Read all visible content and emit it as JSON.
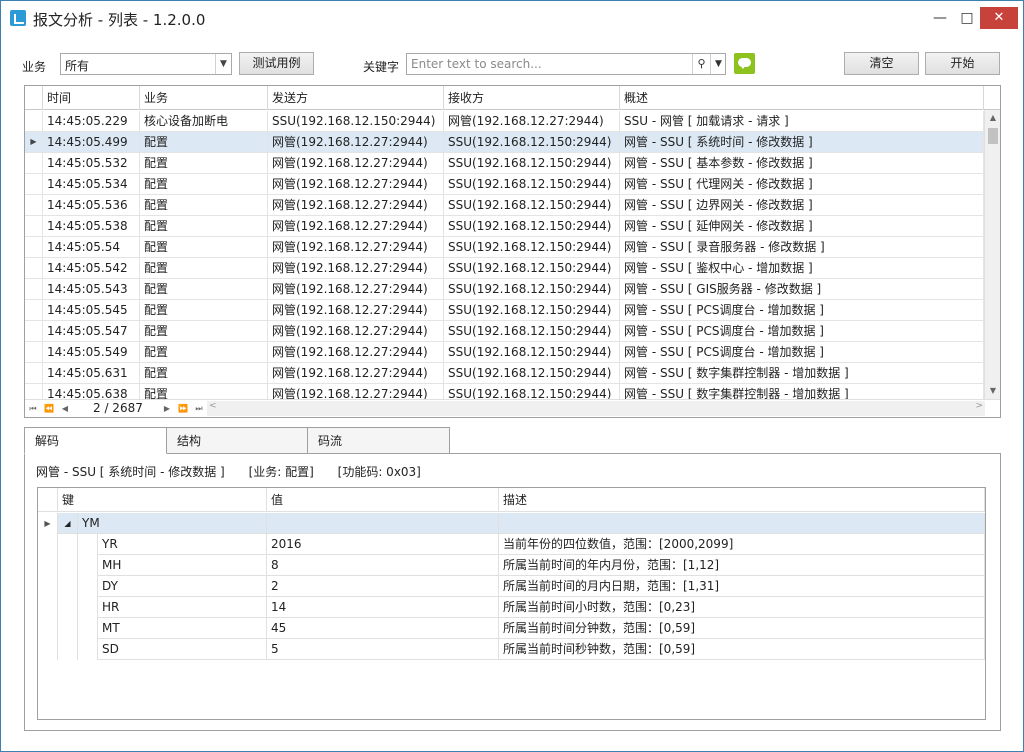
{
  "window": {
    "title": "报文分析 - 列表 - 1.2.0.0",
    "min_icon": "minimize-icon",
    "max_icon": "maximize-icon",
    "close_icon": "close-icon",
    "close_color": "#c7423a"
  },
  "toolbar": {
    "business_label": "业务",
    "business_value": "所有",
    "test_button": "测试用例",
    "keyword_label": "关键字",
    "search_placeholder": "Enter text to search...",
    "clear_button": "清空",
    "start_button": "开始",
    "chat_icon_color": "#8dc21f"
  },
  "grid": {
    "columns": [
      "时间",
      "业务",
      "发送方",
      "接收方",
      "概述"
    ],
    "rows": [
      [
        "14:45:05.229",
        "核心设备加断电",
        "SSU(192.168.12.150:2944)",
        "网管(192.168.12.27:2944)",
        "SSU - 网管 [ 加载请求 - 请求 ]"
      ],
      [
        "14:45:05.499",
        "配置",
        "网管(192.168.12.27:2944)",
        "SSU(192.168.12.150:2944)",
        "网管 - SSU [ 系统时间 - 修改数据 ]"
      ],
      [
        "14:45:05.532",
        "配置",
        "网管(192.168.12.27:2944)",
        "SSU(192.168.12.150:2944)",
        "网管 - SSU [ 基本参数 - 修改数据 ]"
      ],
      [
        "14:45:05.534",
        "配置",
        "网管(192.168.12.27:2944)",
        "SSU(192.168.12.150:2944)",
        "网管 - SSU [ 代理网关 - 修改数据 ]"
      ],
      [
        "14:45:05.536",
        "配置",
        "网管(192.168.12.27:2944)",
        "SSU(192.168.12.150:2944)",
        "网管 - SSU [ 边界网关 - 修改数据 ]"
      ],
      [
        "14:45:05.538",
        "配置",
        "网管(192.168.12.27:2944)",
        "SSU(192.168.12.150:2944)",
        "网管 - SSU [ 延伸网关 - 修改数据 ]"
      ],
      [
        "14:45:05.54",
        "配置",
        "网管(192.168.12.27:2944)",
        "SSU(192.168.12.150:2944)",
        "网管 - SSU [ 录音服务器 - 修改数据 ]"
      ],
      [
        "14:45:05.542",
        "配置",
        "网管(192.168.12.27:2944)",
        "SSU(192.168.12.150:2944)",
        "网管 - SSU [ 鉴权中心 - 增加数据 ]"
      ],
      [
        "14:45:05.543",
        "配置",
        "网管(192.168.12.27:2944)",
        "SSU(192.168.12.150:2944)",
        "网管 - SSU [ GIS服务器 - 修改数据 ]"
      ],
      [
        "14:45:05.545",
        "配置",
        "网管(192.168.12.27:2944)",
        "SSU(192.168.12.150:2944)",
        "网管 - SSU [ PCS调度台 - 增加数据 ]"
      ],
      [
        "14:45:05.547",
        "配置",
        "网管(192.168.12.27:2944)",
        "SSU(192.168.12.150:2944)",
        "网管 - SSU [ PCS调度台 - 增加数据 ]"
      ],
      [
        "14:45:05.549",
        "配置",
        "网管(192.168.12.27:2944)",
        "SSU(192.168.12.150:2944)",
        "网管 - SSU [ PCS调度台 - 增加数据 ]"
      ],
      [
        "14:45:05.631",
        "配置",
        "网管(192.168.12.27:2944)",
        "SSU(192.168.12.150:2944)",
        "网管 - SSU [ 数字集群控制器 - 增加数据 ]"
      ],
      [
        "14:45:05.638",
        "配置",
        "网管(192.168.12.27:2944)",
        "SSU(192.168.12.150:2944)",
        "网管 - SSU [ 数字集群控制器 - 增加数据 ]"
      ]
    ],
    "selected_row": 1,
    "pager": "2 / 2687"
  },
  "tabs": [
    "解码",
    "结构",
    "码流"
  ],
  "active_tab": 0,
  "detail": {
    "summary": "网管 - SSU [ 系统时间 - 修改数据 ]",
    "business": "[业务: 配置]",
    "function_code": "[功能码: 0x03]",
    "columns": [
      "键",
      "值",
      "描述"
    ],
    "group": "YM",
    "rows": [
      [
        "YR",
        "2016",
        "当前年份的四位数值，范围：[2000,2099]"
      ],
      [
        "MH",
        "8",
        "所属当前时间的年内月份，范围：[1,12]"
      ],
      [
        "DY",
        "2",
        "所属当前时间的月内日期，范围：[1,31]"
      ],
      [
        "HR",
        "14",
        "所属当前时间小时数，范围：[0,23]"
      ],
      [
        "MT",
        "45",
        "所属当前时间分钟数，范围：[0,59]"
      ],
      [
        "SD",
        "5",
        "所属当前时间秒钟数，范围：[0,59]"
      ]
    ]
  }
}
